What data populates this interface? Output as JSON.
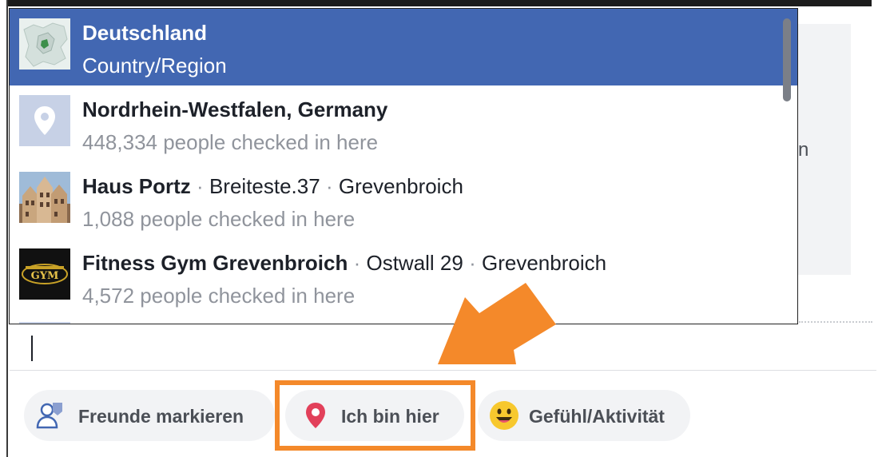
{
  "dropdown": {
    "items": [
      {
        "name": "Deutschland",
        "sub": "Country/Region",
        "selected": true,
        "thumb": "map-thumbnail"
      },
      {
        "name": "Nordrhein-Westfalen, Germany",
        "sub": "448,334 people checked in here",
        "thumb": "location-pin-thumbnail"
      },
      {
        "name": "Haus Portz",
        "address": "Breiteste.37",
        "city": "Grevenbroich",
        "sep": "·",
        "sub": "1,088 people checked in here",
        "thumb": "building-photo"
      },
      {
        "name": "Fitness Gym Grevenbroich",
        "address": "Ostwall 29",
        "city": "Grevenbroich",
        "sep": "·",
        "sub": "4,572 people checked in here",
        "thumb": "gym-logo",
        "logo_text": "GYM"
      }
    ]
  },
  "background": {
    "partial_letter": "n"
  },
  "toolbar": {
    "tag_friends": {
      "label": "Freunde markieren",
      "icon": "tag-friends-icon"
    },
    "check_in": {
      "label": "Ich bin hier",
      "icon": "location-pin-icon"
    },
    "feeling": {
      "label": "Gefühl/Aktivität",
      "icon": "smiley-icon"
    }
  },
  "colors": {
    "selected_row": "#4267b2",
    "annotation": "#f4892a",
    "pill_background": "#f2f3f5",
    "pin_red": "#e2405a"
  }
}
